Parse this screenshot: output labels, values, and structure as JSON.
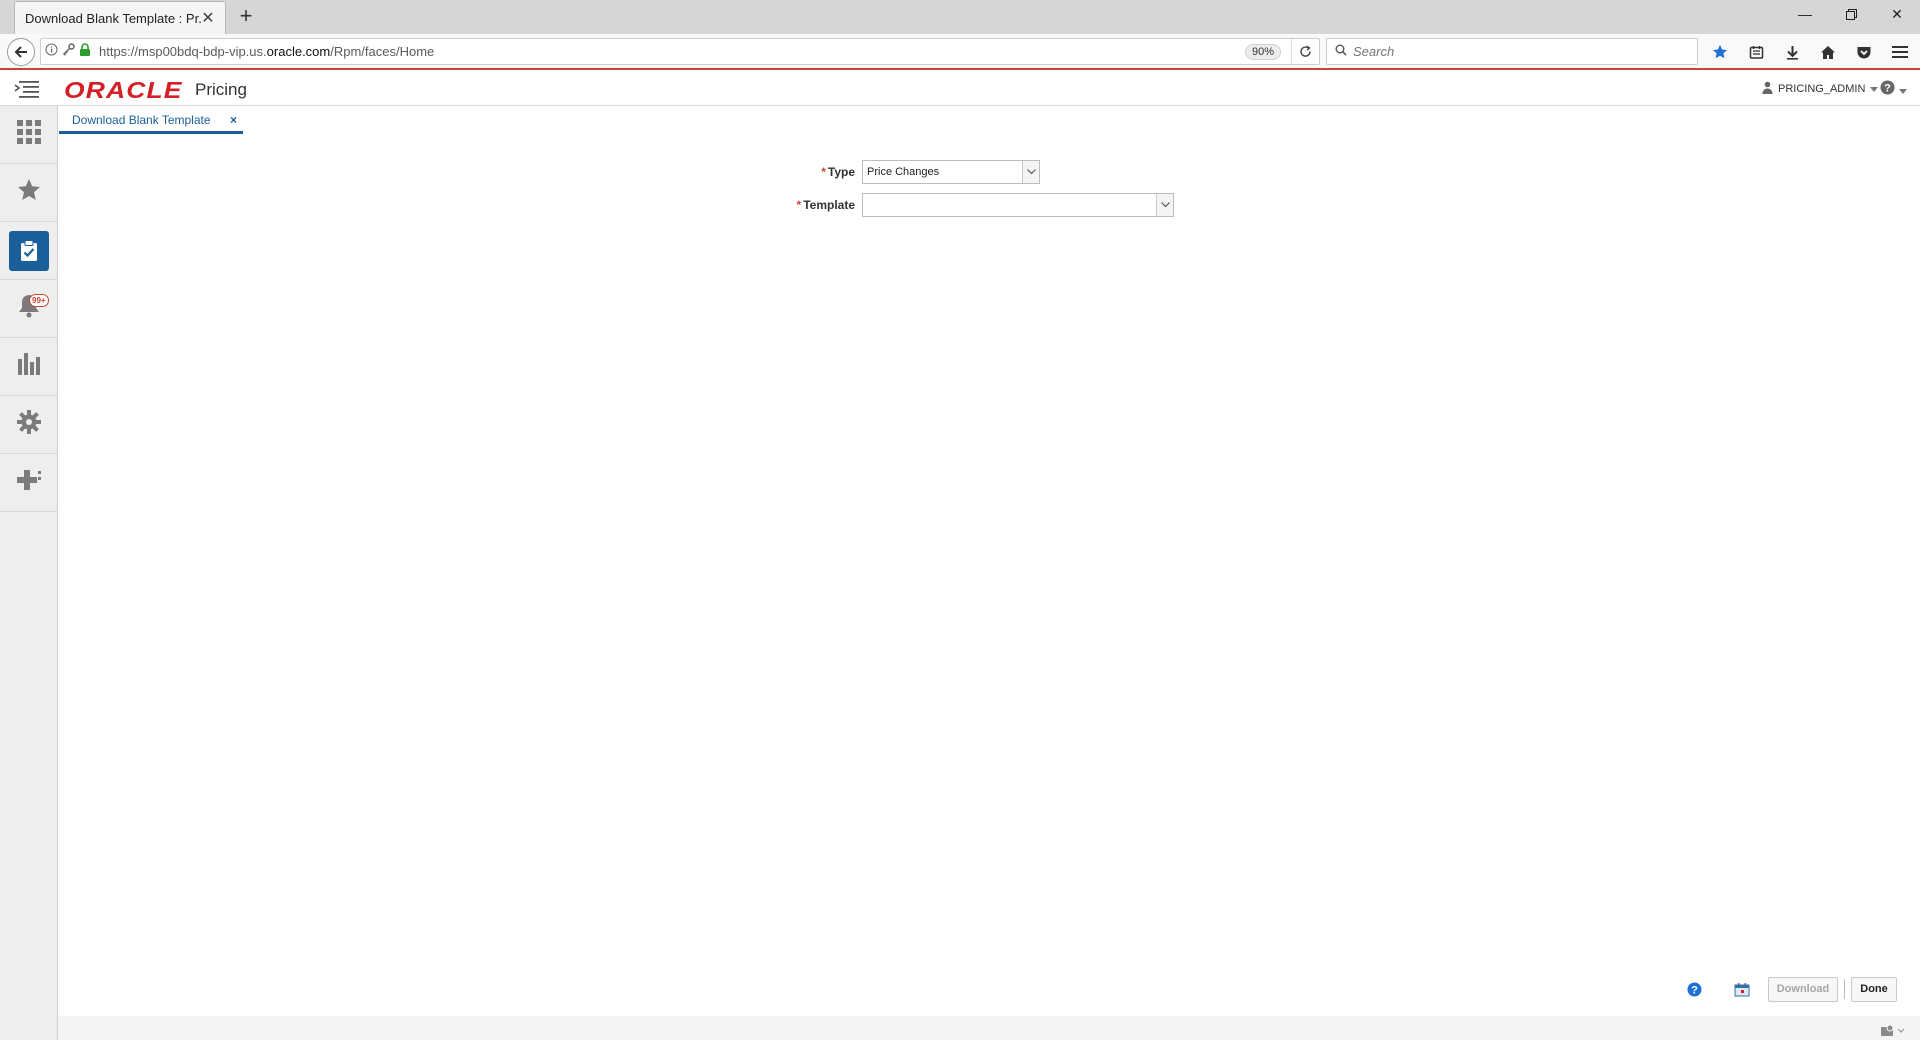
{
  "browser": {
    "tab_title": "Download Blank Template : Pr...",
    "url_prefix": "https://msp00bdq-bdp-vip.us.",
    "url_domain": "oracle.com",
    "url_suffix": "/Rpm/faces/Home",
    "zoom": "90%",
    "search_placeholder": "Search"
  },
  "app": {
    "logo": "ORACLE",
    "product": "Pricing",
    "user": "PRICING_ADMIN"
  },
  "sidebar": {
    "notifications_count": "99+"
  },
  "content_tab": {
    "label": "Download Blank Template",
    "close": "×"
  },
  "form": {
    "type_label": "Type",
    "type_value": "Price Changes",
    "template_label": "Template",
    "template_value": "",
    "required_marker": "*"
  },
  "footer": {
    "download_label": "Download",
    "done_label": "Done"
  },
  "colors": {
    "accent": "#1a5f9b",
    "brand_red": "#d41f26"
  }
}
